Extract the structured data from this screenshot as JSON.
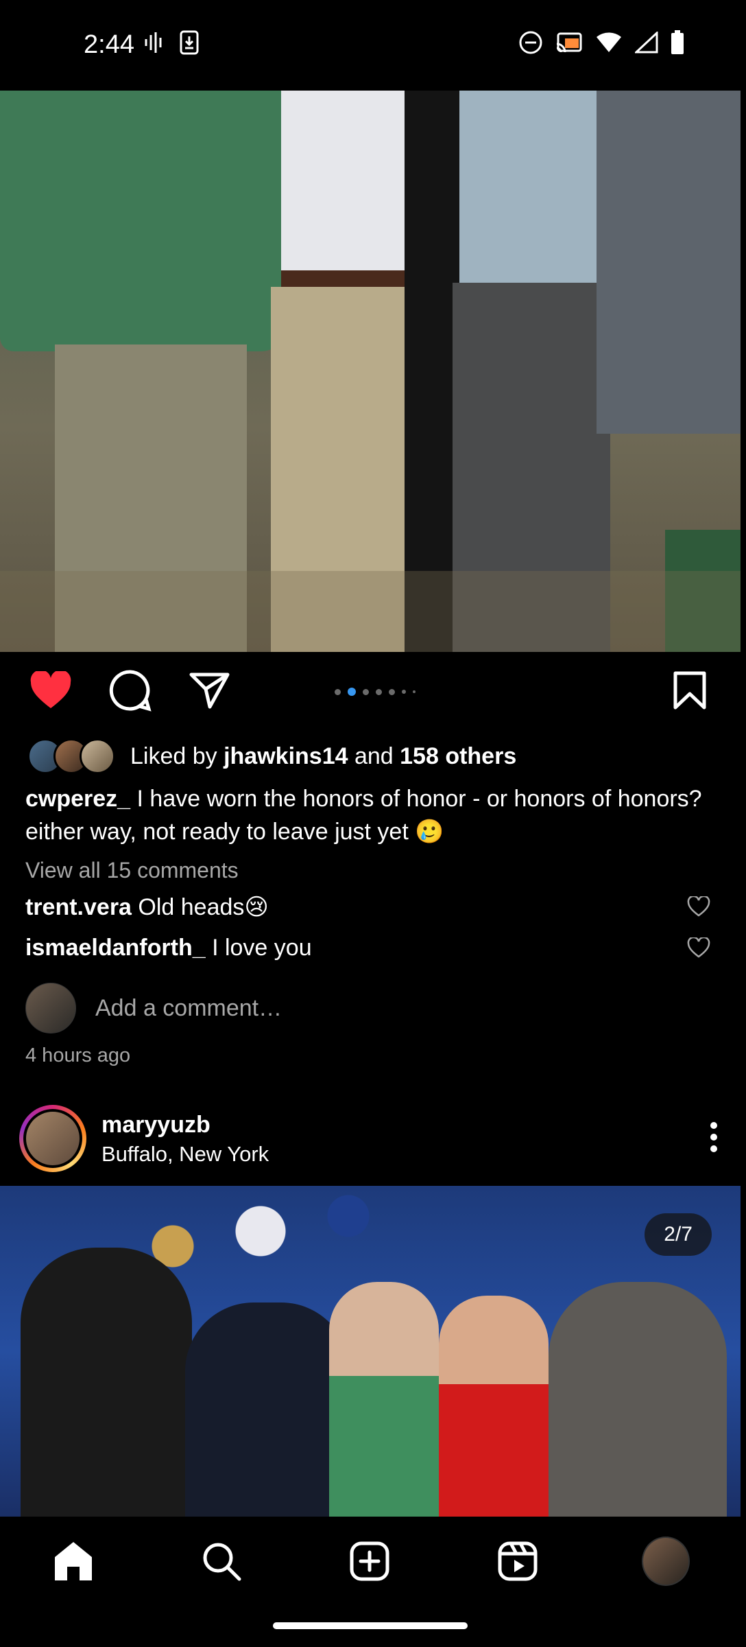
{
  "status_bar": {
    "time": "2:44"
  },
  "post1": {
    "likes": {
      "prefix": "Liked by ",
      "user": "jhawkins14",
      "middle": " and ",
      "others": "158 others"
    },
    "caption": {
      "user": "cwperez_",
      "text": " I have worn the honors of honor - or honors of honors? either way, not ready to leave just yet 🥲"
    },
    "view_all": "View all 15 comments",
    "comments": [
      {
        "user": "trent.vera",
        "text": " Old heads😢"
      },
      {
        "user": "ismaeldanforth_",
        "text": " I love you"
      }
    ],
    "add_comment_placeholder": "Add a comment…",
    "time_ago": "4 hours ago",
    "carousel": {
      "count": 7,
      "active": 2
    }
  },
  "post2": {
    "username": "maryyuzb",
    "location": "Buffalo, New York",
    "counter": "2/7"
  },
  "colors": {
    "like": "#ff3040",
    "accent": "#3797f0",
    "secondary_text": "#a8a8a8"
  },
  "icons": [
    "heart-filled-icon",
    "comment-icon",
    "share-icon",
    "bookmark-icon",
    "home-icon",
    "search-icon",
    "create-icon",
    "reels-icon"
  ]
}
